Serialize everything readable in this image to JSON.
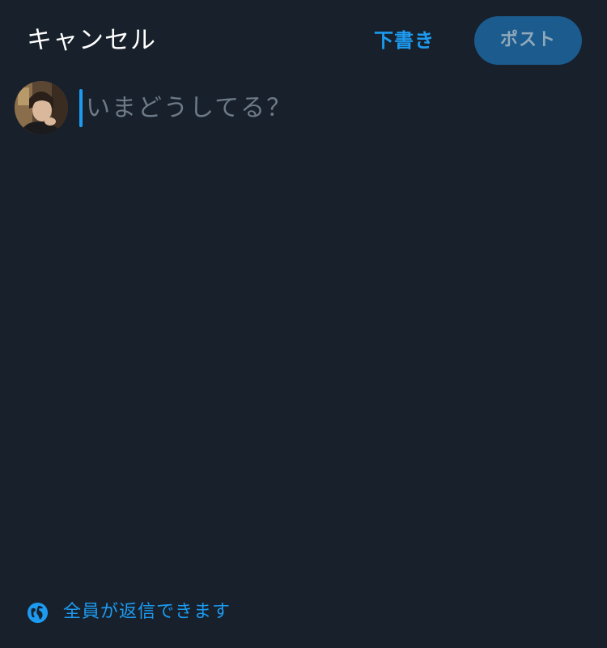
{
  "header": {
    "cancel_label": "キャンセル",
    "drafts_label": "下書き",
    "post_label": "ポスト"
  },
  "composer": {
    "placeholder": "いまどうしてる？",
    "value": ""
  },
  "reply_setting": {
    "icon": "globe-icon",
    "label": "全員が返信できます"
  },
  "colors": {
    "background": "#17202b",
    "accent": "#1d9bf0",
    "post_button_disabled": "#1b5b8e",
    "placeholder_text": "#6e7a88"
  }
}
